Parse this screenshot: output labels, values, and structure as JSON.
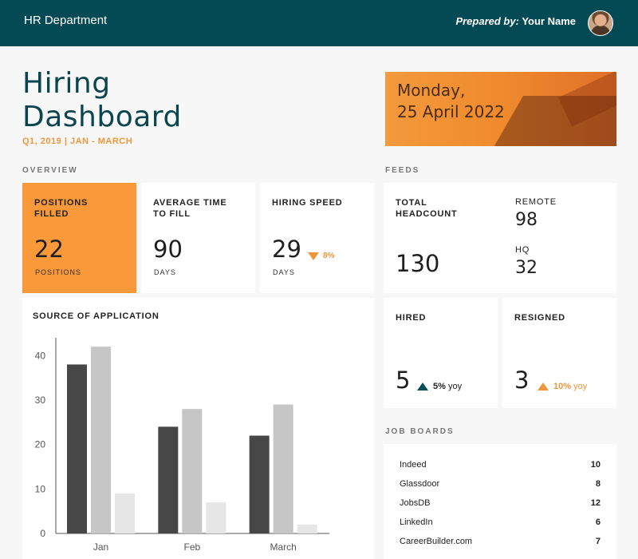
{
  "header": {
    "department": "HR Department",
    "prepared_label": "Prepared by:",
    "prepared_name": "Your Name"
  },
  "page": {
    "title_line1": "Hiring",
    "title_line2": "Dashboard",
    "subtitle": "Q1, 2019 | JAN - MARCH"
  },
  "date": {
    "line1": "Monday,",
    "line2": "25 April 2022"
  },
  "overview": {
    "label": "OVERVIEW",
    "positions": {
      "title": "POSITIONS FILLED",
      "value": "22",
      "unit": "POSITIONS"
    },
    "avg_time": {
      "title": "AVERAGE TIME TO FILL",
      "value": "90",
      "unit": "DAYS"
    },
    "speed": {
      "title": "HIRING SPEED",
      "value": "29",
      "change": "8%",
      "unit": "DAYS"
    }
  },
  "feeds": {
    "label": "FEEDS",
    "headcount": {
      "title": "TOTAL HEADCOUNT",
      "value": "130"
    },
    "remote": {
      "label": "REMOTE",
      "value": "98"
    },
    "hq": {
      "label": "HQ",
      "value": "32"
    },
    "hired": {
      "title": "HIRED",
      "value": "5",
      "change": "5%",
      "suffix": "yoy"
    },
    "resigned": {
      "title": "RESIGNED",
      "value": "3",
      "change": "10%",
      "suffix": "yoy"
    }
  },
  "job_boards": {
    "label": "JOB BOARDS",
    "rows": [
      {
        "name": "Indeed",
        "count": "10"
      },
      {
        "name": "Glassdoor",
        "count": "8"
      },
      {
        "name": "JobsDB",
        "count": "12"
      },
      {
        "name": "LinkedIn",
        "count": "6"
      },
      {
        "name": "CareerBuilder.com",
        "count": "7"
      }
    ]
  },
  "colors": {
    "header_bg": "#034a55",
    "accent_orange": "#f9993a",
    "series_dark": "#474747",
    "series_mid": "#c6c6c6",
    "series_light": "#e6e6e6"
  },
  "chart_data": {
    "type": "bar",
    "title": "SOURCE OF APPLICATION",
    "categories": [
      "Jan",
      "Feb",
      "March"
    ],
    "series": [
      {
        "values": [
          38,
          24,
          22
        ]
      },
      {
        "values": [
          42,
          28,
          29
        ]
      },
      {
        "values": [
          9,
          7,
          2
        ]
      }
    ],
    "yticks": [
      0,
      10,
      20,
      30,
      40
    ],
    "ylim": [
      0,
      44
    ],
    "grid": false,
    "legend": "none"
  }
}
